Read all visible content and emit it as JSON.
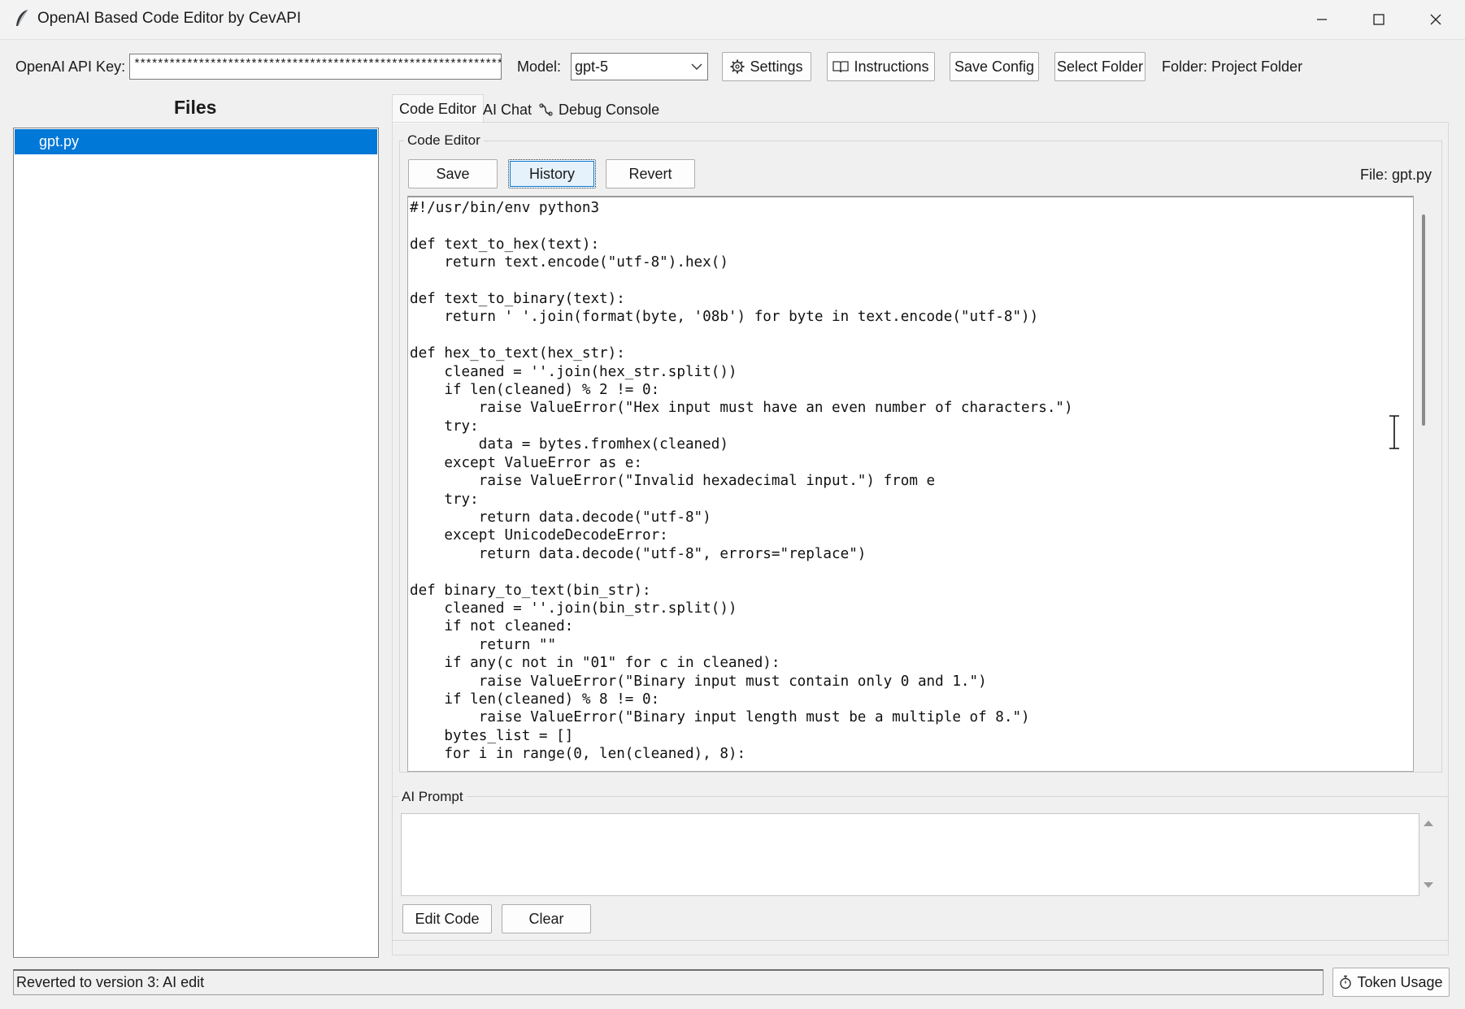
{
  "window": {
    "title": "OpenAI Based Code Editor by CevAPI",
    "icons": {
      "app": "feather-icon",
      "minimize": "minimize-icon",
      "maximize": "maximize-icon",
      "close": "close-icon"
    }
  },
  "toolbar": {
    "api_key_label": "OpenAI API Key:",
    "api_key_value": "****************************************************************",
    "model_label": "Model:",
    "model_value": "gpt-5",
    "settings_label": "Settings",
    "instructions_label": "Instructions",
    "save_config_label": "Save Config",
    "select_folder_label": "Select Folder",
    "folder_text": "Folder: Project Folder"
  },
  "files": {
    "heading": "Files",
    "items": [
      {
        "name": "gpt.py",
        "selected": true
      }
    ]
  },
  "tabs": [
    {
      "label": "Code Editor",
      "active": true
    },
    {
      "label": "AI Chat",
      "active": false
    },
    {
      "label": "Debug Console",
      "active": false,
      "icon": "bug-icon"
    }
  ],
  "editor": {
    "group_label": "Code Editor",
    "save_label": "Save",
    "history_label": "History",
    "revert_label": "Revert",
    "file_label": "File: gpt.py",
    "code": "#!/usr/bin/env python3\n\ndef text_to_hex(text):\n    return text.encode(\"utf-8\").hex()\n\ndef text_to_binary(text):\n    return ' '.join(format(byte, '08b') for byte in text.encode(\"utf-8\"))\n\ndef hex_to_text(hex_str):\n    cleaned = ''.join(hex_str.split())\n    if len(cleaned) % 2 != 0:\n        raise ValueError(\"Hex input must have an even number of characters.\")\n    try:\n        data = bytes.fromhex(cleaned)\n    except ValueError as e:\n        raise ValueError(\"Invalid hexadecimal input.\") from e\n    try:\n        return data.decode(\"utf-8\")\n    except UnicodeDecodeError:\n        return data.decode(\"utf-8\", errors=\"replace\")\n\ndef binary_to_text(bin_str):\n    cleaned = ''.join(bin_str.split())\n    if not cleaned:\n        return \"\"\n    if any(c not in \"01\" for c in cleaned):\n        raise ValueError(\"Binary input must contain only 0 and 1.\")\n    if len(cleaned) % 8 != 0:\n        raise ValueError(\"Binary input length must be a multiple of 8.\")\n    bytes_list = []\n    for i in range(0, len(cleaned), 8):"
  },
  "prompt": {
    "group_label": "AI Prompt",
    "value": "",
    "edit_code_label": "Edit Code",
    "clear_label": "Clear"
  },
  "status": {
    "text": "Reverted to version 3: AI edit",
    "token_usage_label": "Token Usage"
  },
  "colors": {
    "selection": "#0078d7",
    "background": "#f0f0f0"
  }
}
